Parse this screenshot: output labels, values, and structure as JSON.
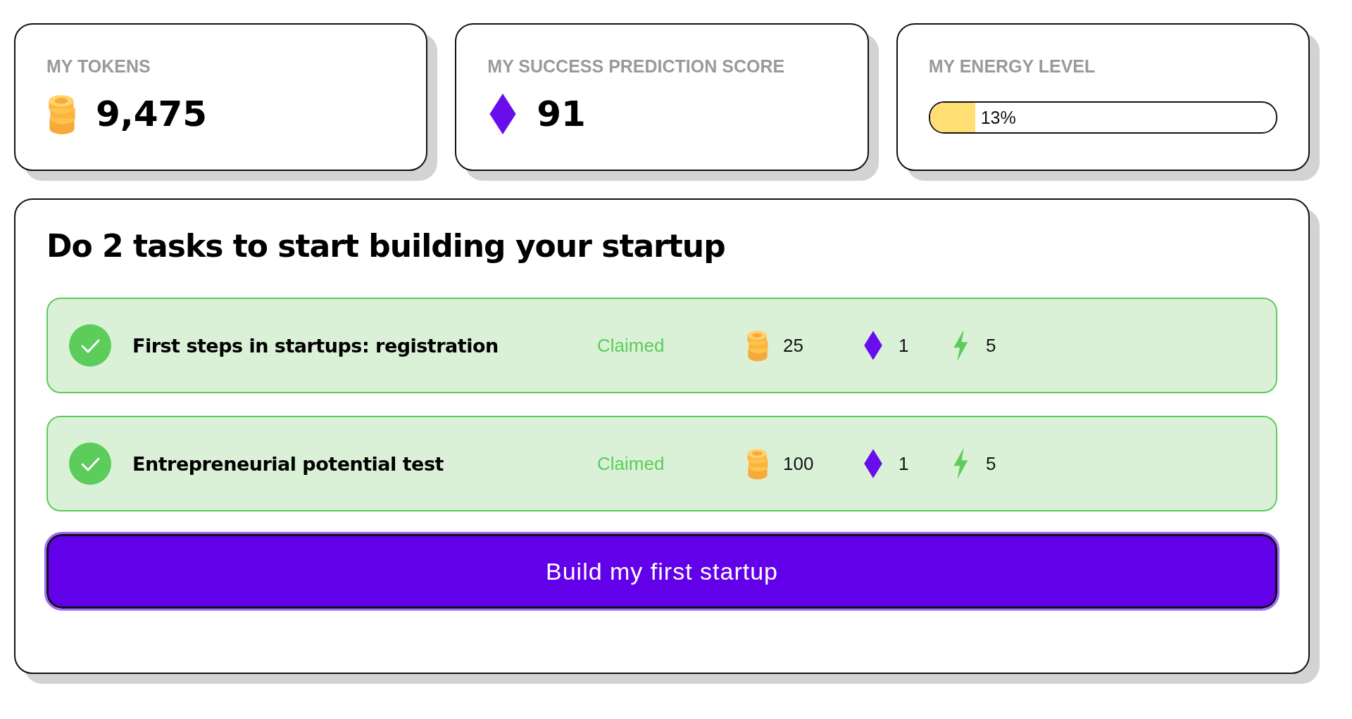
{
  "stats": [
    {
      "kind": "tokens",
      "label": "MY TOKENS",
      "value": "9,475"
    },
    {
      "kind": "score",
      "label": "MY SUCCESS PREDICTION SCORE",
      "value": "91"
    },
    {
      "kind": "energy",
      "label": "MY ENERGY LEVEL",
      "level": 0.13,
      "reading": "13%"
    }
  ],
  "tasks_panel": {
    "title": "Do 2 tasks to start building your startup",
    "tasks": [
      {
        "title": "First steps in startups: registration",
        "done": true,
        "status": "Claimed",
        "tokens": "25",
        "score": "1",
        "energy": "5"
      },
      {
        "title": "Entrepreneurial potential test",
        "done": true,
        "status": "Claimed",
        "tokens": "100",
        "score": "1",
        "energy": "5"
      }
    ],
    "button": "Build my first startup"
  }
}
